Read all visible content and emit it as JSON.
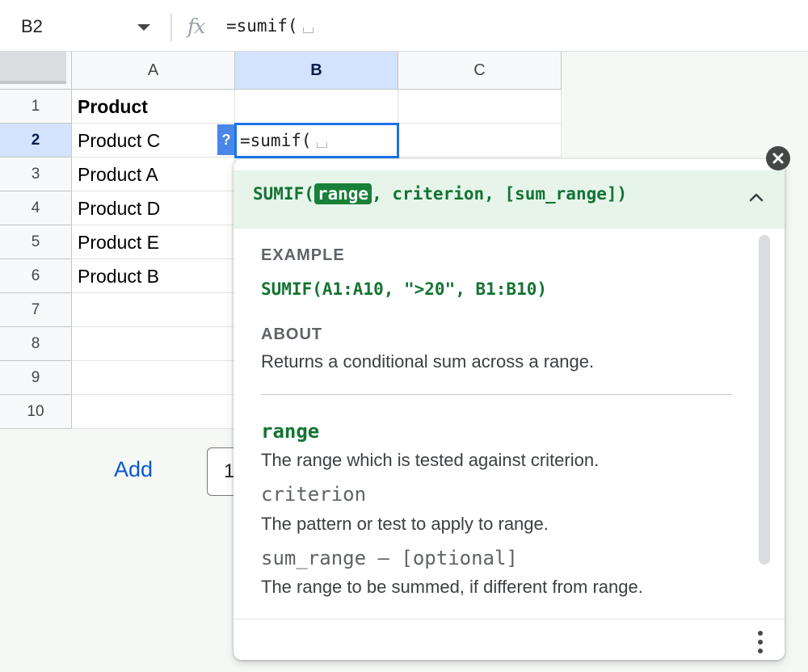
{
  "formula_bar": {
    "name_box": "B2",
    "fx_icon": "fx-icon",
    "formula": "=sumif("
  },
  "sheet": {
    "columns": [
      "A",
      "B",
      "C"
    ],
    "selected_column": "B",
    "rows": [
      "1",
      "2",
      "3",
      "4",
      "5",
      "6",
      "7",
      "8",
      "9",
      "10"
    ],
    "selected_row": "2",
    "column_a": [
      "Product",
      "Product C",
      "Product A",
      "Product D",
      "Product E",
      "Product B",
      "",
      "",
      "",
      ""
    ],
    "active_cell": {
      "ref": "B2",
      "value": "=sumif("
    },
    "help_badge": "?"
  },
  "below_grid": {
    "add_label": "Add",
    "rows_value": "1"
  },
  "function_help": {
    "signature": {
      "name": "SUMIF(",
      "active_arg": "range",
      "rest": ", criterion, [sum_range])"
    },
    "example_label": "EXAMPLE",
    "example": "SUMIF(A1:A10, \">20\", B1:B10)",
    "about_label": "ABOUT",
    "about": "Returns a conditional sum across a range.",
    "args": [
      {
        "name": "range",
        "description": "The range which is tested against criterion.",
        "current": true
      },
      {
        "name": "criterion",
        "description": "The pattern or test to apply to range.",
        "current": false
      },
      {
        "name": "sum_range – [optional]",
        "description": "The range to be summed, if different from range.",
        "current": false
      }
    ],
    "icons": {
      "close": "close-icon",
      "collapse": "chevron-up-icon",
      "more": "more-vert-icon"
    }
  },
  "colors": {
    "accent_blue": "#1a73e8",
    "header_selected": "#d3e3fd",
    "help_green": "#137333",
    "help_bg": "#e6f4ea",
    "link_blue": "#0b57d0"
  }
}
